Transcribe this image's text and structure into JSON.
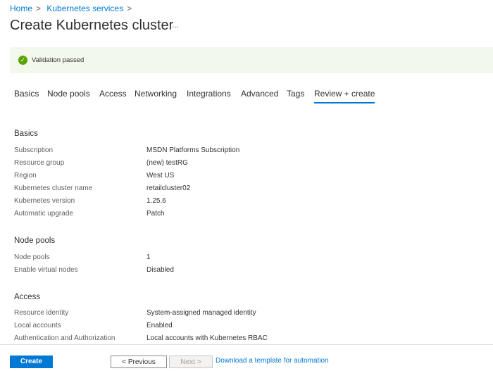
{
  "breadcrumb": [
    "Home",
    "Kubernetes services"
  ],
  "title": "Create Kubernetes cluster",
  "more": "...",
  "validation": "Validation passed",
  "tabs": [
    "Basics",
    "Node pools",
    "Access",
    "Networking",
    "Integrations",
    "Advanced",
    "Tags",
    "Review + create"
  ],
  "sections": [
    {
      "title": "Basics",
      "rows": [
        [
          "Subscription",
          "MSDN Platforms Subscription"
        ],
        [
          "Resource group",
          "(new) testRG"
        ],
        [
          "Region",
          "West US"
        ],
        [
          "Kubernetes cluster name",
          "retailcluster02"
        ],
        [
          "Kubernetes version",
          "1.25.6"
        ],
        [
          "Automatic upgrade",
          "Patch"
        ]
      ]
    },
    {
      "title": "Node pools",
      "rows": [
        [
          "Node pools",
          "1"
        ],
        [
          "Enable virtual nodes",
          "Disabled"
        ]
      ]
    },
    {
      "title": "Access",
      "rows": [
        [
          "Resource identity",
          "System-assigned managed identity"
        ],
        [
          "Local accounts",
          "Enabled"
        ],
        [
          "Authentication and Authorization",
          "Local accounts with Kubernetes RBAC"
        ]
      ]
    }
  ],
  "footer": {
    "create": "Create",
    "previous": "< Previous",
    "next": "Next >",
    "download": "Download a template for automation"
  }
}
